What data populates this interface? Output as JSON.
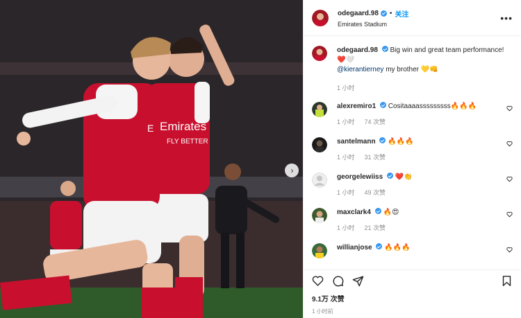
{
  "post": {
    "username": "odegaard.98",
    "follow_label": "关注",
    "separator": "•",
    "location": "Emirates Stadium",
    "more_label": "•••"
  },
  "caption": {
    "username": "odegaard.98",
    "text": "Big win and great team performance!",
    "emoji_line": "❤️🤍",
    "mention": "@kierantierney",
    "mention_tail": "my brother",
    "mention_emoji": "💛👊",
    "time": "1 小时"
  },
  "comments": [
    {
      "username": "alexremiro1",
      "text": "Cositaaaasssssssss",
      "emoji": "🔥🔥🔥",
      "time": "1 小时",
      "likes": "74 次赞"
    },
    {
      "username": "santelmann",
      "text": "",
      "emoji": "🔥🔥🔥",
      "time": "1 小时",
      "likes": "31 次赞"
    },
    {
      "username": "georgelewiiss",
      "text": "",
      "emoji": "❤️👏",
      "time": "1 小时",
      "likes": "49 次赞"
    },
    {
      "username": "maxclark4",
      "text": "",
      "emoji": "🔥😍",
      "time": "1 小时",
      "likes": "21 次赞"
    },
    {
      "username": "willianjose",
      "text": "",
      "emoji": "🔥🔥🔥",
      "time": "",
      "likes": ""
    }
  ],
  "stats": {
    "likes": "9.1万 次赞",
    "time": "1 小时前"
  },
  "icons": {
    "like": "heart-outline-icon",
    "comment": "comment-bubble-icon",
    "share": "paper-plane-icon",
    "save": "bookmark-icon",
    "next": "chevron-right-icon"
  },
  "photo": {
    "shirt_text": "Emirates",
    "shirt_sub": "FLY BETTER"
  },
  "colors": {
    "accent": "#0095f6",
    "verified": "#3897f0",
    "like_red": "#ed4956",
    "arsenal_red": "#c8102e"
  }
}
